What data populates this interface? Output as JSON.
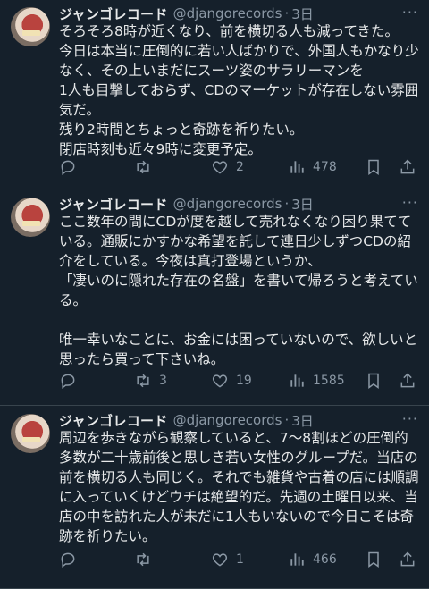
{
  "tweets": [
    {
      "name": "ジャンゴレコード",
      "handle": "@djangorecords",
      "sep": "·",
      "time": "3日",
      "text": "そろそろ8時が近くなり、前を横切る人も減ってきた。\n今日は本当に圧倒的に若い人ばかりで、外国人もかなり少なく、その上いまだにスーツ姿のサラリーマンを\n1人も目撃しておらず、CDのマーケットが存在しない雰囲気だ。\n残り2時間とちょっと奇跡を祈りたい。\n閉店時刻も近々9時に変更予定。",
      "replies": "",
      "retweets": "",
      "likes": "2",
      "views": "478"
    },
    {
      "name": "ジャンゴレコード",
      "handle": "@djangorecords",
      "sep": "·",
      "time": "3日",
      "text": "ここ数年の間にCDが度を越して売れなくなり困り果てている。通販にかすかな希望を託して連日少しずつCDの紹介をしている。今夜は真打登場というか、\n「凄いのに隠れた存在の名盤」を書いて帰ろうと考えている。\n\n唯一幸いなことに、お金には困っていないので、欲しいと思ったら買って下さいね。",
      "replies": "",
      "retweets": "3",
      "likes": "19",
      "views": "1585"
    },
    {
      "name": "ジャンゴレコード",
      "handle": "@djangorecords",
      "sep": "·",
      "time": "3日",
      "text": "周辺を歩きながら観察していると、7〜8割ほどの圧倒的多数が二十歳前後と思しき若い女性のグループだ。当店の前を横切る人も同じく。それでも雑貨や古着の店には順調に入っていくけどウチは絶望的だ。先週の土曜日以来、当店の中を訪れた人が未だに1人もいないので今日こそは奇跡を祈りたい。",
      "replies": "",
      "retweets": "",
      "likes": "1",
      "views": "466"
    }
  ],
  "icons": {
    "reply": "reply-icon",
    "retweet": "retweet-icon",
    "like": "heart-icon",
    "views": "views-icon",
    "bookmark": "bookmark-icon",
    "share": "share-icon",
    "more": "more-icon"
  },
  "colors": {
    "background": "#15202b",
    "text": "#e7e9ea",
    "muted": "#8b98a5",
    "divider": "#38444d"
  }
}
